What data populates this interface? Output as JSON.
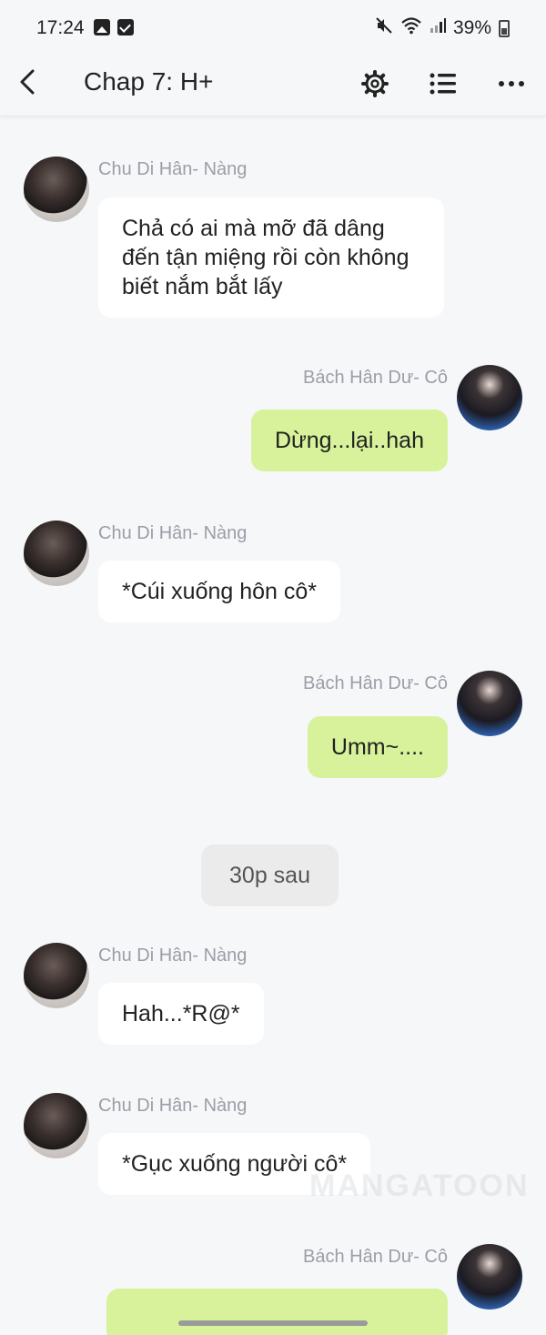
{
  "status_bar": {
    "time": "17:24",
    "battery": "39%",
    "icons": [
      "image-icon",
      "check-icon",
      "mute-icon",
      "wifi-icon",
      "signal-icon",
      "battery-icon"
    ]
  },
  "header": {
    "title": "Chap 7: H+",
    "icons": [
      "back-icon",
      "gear-icon",
      "list-icon",
      "more-icon"
    ]
  },
  "messages": [
    {
      "side": "left",
      "sender": "Chu Di Hân- Nàng",
      "text": "Chả có ai mà mỡ đã dâng đến tận miệng rồi còn không biết nắm bắt lấy"
    },
    {
      "side": "right",
      "sender": "Bách Hân Dư- Cô",
      "text": "Dừng...lại..hah"
    },
    {
      "side": "left",
      "sender": "Chu Di Hân- Nàng",
      "text": "*Cúi xuống hôn cô*"
    },
    {
      "side": "right",
      "sender": "Bách Hân Dư- Cô",
      "text": "Umm~...."
    },
    {
      "side": "center",
      "sender": "",
      "text": "30p sau"
    },
    {
      "side": "left",
      "sender": "Chu Di Hân- Nàng",
      "text": "Hah...*R@*"
    },
    {
      "side": "left",
      "sender": "Chu Di Hân- Nàng",
      "text": "*Gục xuống người cô*"
    },
    {
      "side": "right",
      "sender": "Bách Hân Dư- Cô",
      "text": ""
    }
  ],
  "watermark": "MANGATOON",
  "colors": {
    "background": "#f6f7f9",
    "bubble_white": "#ffffff",
    "bubble_green": "#d7f29a",
    "bubble_system": "#ebebeb",
    "sender_name": "#9a9ea6"
  }
}
